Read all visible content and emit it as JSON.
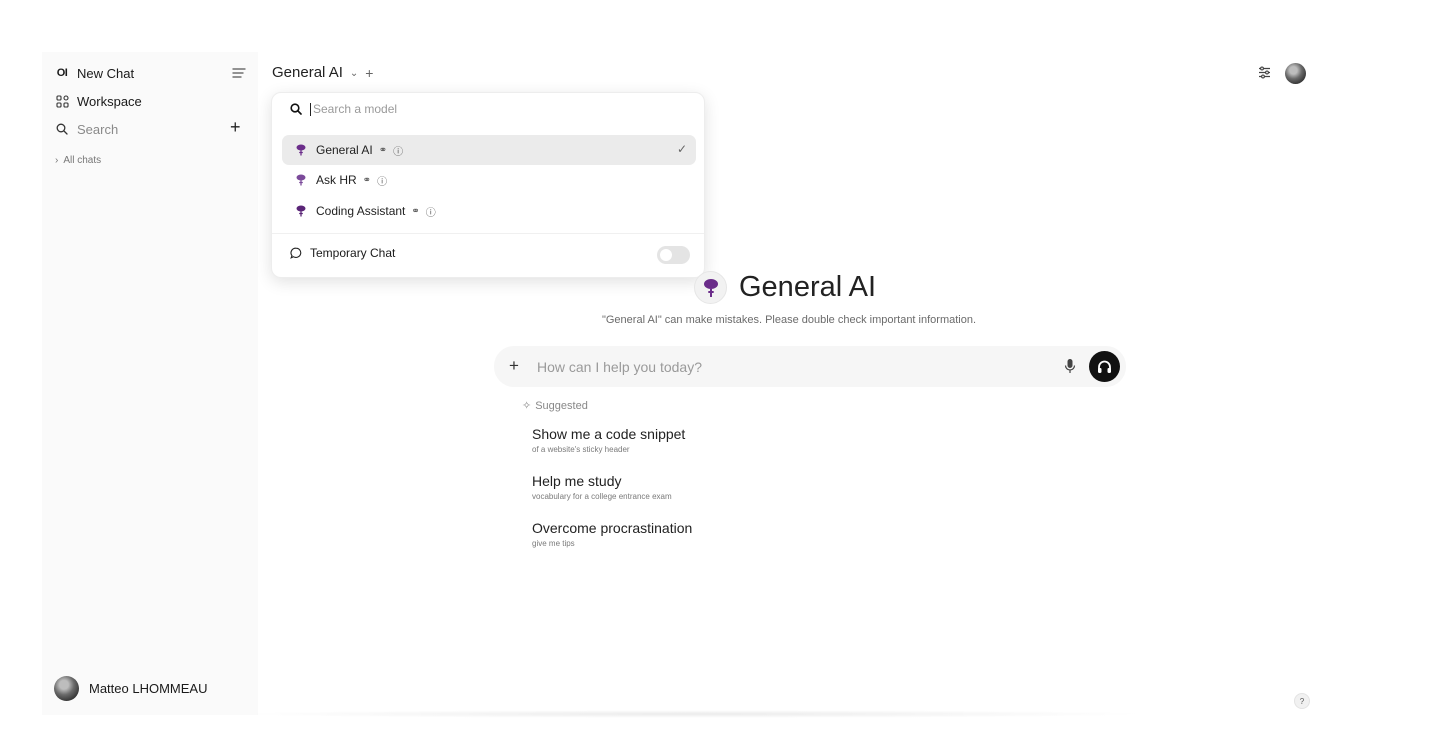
{
  "sidebar": {
    "logo_text": "OI",
    "new_chat_label": "New Chat",
    "workspace_label": "Workspace",
    "search_placeholder": "Search",
    "all_chats_label": "All chats",
    "user_name": "Matteo LHOMMEAU"
  },
  "header": {
    "selected_model": "General AI"
  },
  "model_dropdown": {
    "search_placeholder": "Search a model",
    "models": [
      {
        "name": "General AI",
        "selected": true
      },
      {
        "name": "Ask HR",
        "selected": false
      },
      {
        "name": "Coding Assistant",
        "selected": false
      }
    ],
    "temporary_chat_label": "Temporary Chat",
    "temporary_chat_enabled": false
  },
  "main": {
    "title": "General AI",
    "disclaimer": "\"General AI\" can make mistakes. Please double check important information.",
    "input_placeholder": "How can I help you today?",
    "suggested_label": "Suggested",
    "suggestions": [
      {
        "title": "Show me a code snippet",
        "subtitle": "of a website's sticky header"
      },
      {
        "title": "Help me study",
        "subtitle": "vocabulary for a college entrance exam"
      },
      {
        "title": "Overcome procrastination",
        "subtitle": "give me tips"
      }
    ]
  },
  "help_label": "?",
  "icons": {
    "model": "brain-bulb-icon",
    "check": "check-icon",
    "link": "link-icon",
    "info": "info-icon"
  },
  "colors": {
    "accent_purple": "#6b2d8a",
    "selected_bg": "#ebebeb",
    "sidebar_bg": "#fafafa"
  }
}
